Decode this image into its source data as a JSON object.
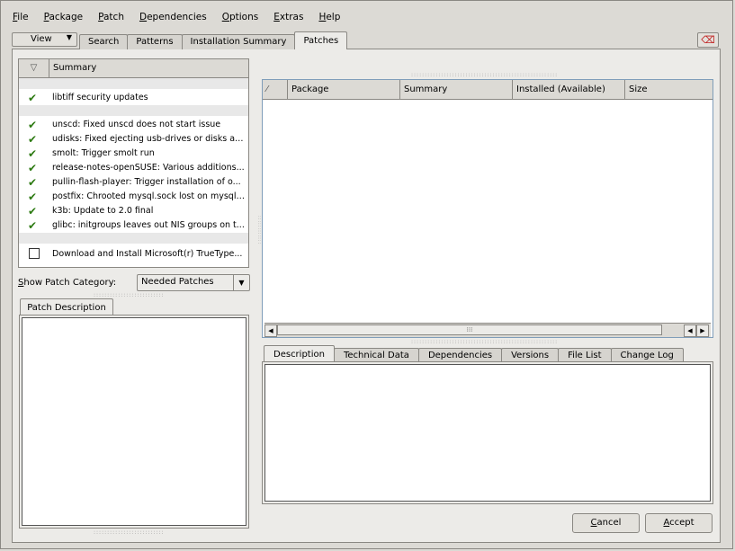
{
  "menu": [
    {
      "label": "File",
      "u": "F",
      "rest": "ile"
    },
    {
      "label": "Package",
      "u": "P",
      "rest": "ackage"
    },
    {
      "label": "Patch",
      "u": "P",
      "rest": "atch"
    },
    {
      "label": "Dependencies",
      "u": "D",
      "rest": "ependencies"
    },
    {
      "label": "Options",
      "u": "O",
      "rest": "ptions"
    },
    {
      "label": "Extras",
      "u": "E",
      "rest": "xtras"
    },
    {
      "label": "Help",
      "u": "H",
      "rest": "elp"
    }
  ],
  "view_button": "View",
  "top_tabs": [
    "Search",
    "Patterns",
    "Installation Summary",
    "Patches"
  ],
  "active_top_tab": "Patches",
  "patch_list": {
    "column_summary": "Summary",
    "items": [
      {
        "status": "checked",
        "text": "libtiff security updates",
        "section": "a"
      },
      {
        "status": "checked",
        "text": "unscd: Fixed unscd does not start issue",
        "section": "b"
      },
      {
        "status": "checked",
        "text": "udisks: Fixed ejecting usb-drives or disks as ...",
        "section": "b"
      },
      {
        "status": "checked",
        "text": "smolt: Trigger smolt run",
        "section": "b"
      },
      {
        "status": "checked",
        "text": "release-notes-openSUSE: Various additions...",
        "section": "b"
      },
      {
        "status": "checked",
        "text": "pullin-flash-player: Trigger installation of o...",
        "section": "b"
      },
      {
        "status": "checked",
        "text": "postfix: Chrooted mysql.sock lost on mysql r...",
        "section": "b"
      },
      {
        "status": "checked",
        "text": "k3b: Update to 2.0 final",
        "section": "b"
      },
      {
        "status": "checked",
        "text": "glibc: initgroups leaves out NIS groups on t...",
        "section": "b"
      },
      {
        "status": "unchecked",
        "text": "Download and Install Microsoft(r) TrueType...",
        "section": "c"
      }
    ]
  },
  "show_patch_category": {
    "label": "Show Patch Category:",
    "value": "Needed Patches"
  },
  "patch_description_tab": "Patch Description",
  "package_table": {
    "columns": [
      "Package",
      "Summary",
      "Installed (Available)",
      "Size"
    ]
  },
  "detail_tabs": [
    "Description",
    "Technical Data",
    "Dependencies",
    "Versions",
    "File List",
    "Change Log"
  ],
  "active_detail_tab": "Description",
  "buttons": {
    "cancel": "Cancel",
    "accept": "Accept"
  }
}
